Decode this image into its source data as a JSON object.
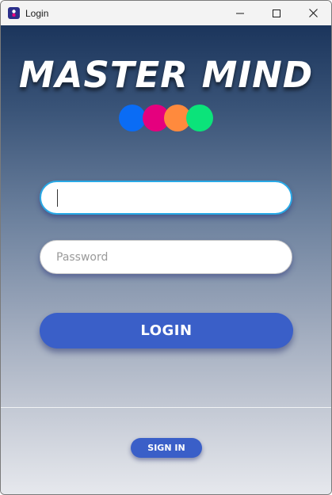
{
  "window": {
    "title": "Login",
    "app_icon": "mastermind-app-icon",
    "controls": {
      "minimize_icon": "minimize-icon",
      "maximize_icon": "maximize-icon",
      "close_icon": "close-icon"
    }
  },
  "logo": {
    "title": "MASTER MIND",
    "dot_colors": [
      "#0a6cf5",
      "#e5007e",
      "#ff8a3d",
      "#0be37a"
    ]
  },
  "form": {
    "username": {
      "value": "",
      "placeholder": ""
    },
    "password": {
      "value": "",
      "placeholder": "Password"
    },
    "login_label": "LOGIN"
  },
  "footer": {
    "signin_label": "SIGN IN"
  },
  "colors": {
    "accent": "#3a5fc8",
    "focus_border": "#29a9e6",
    "background_top": "#1b355c",
    "background_bottom": "#e6e8ed"
  }
}
